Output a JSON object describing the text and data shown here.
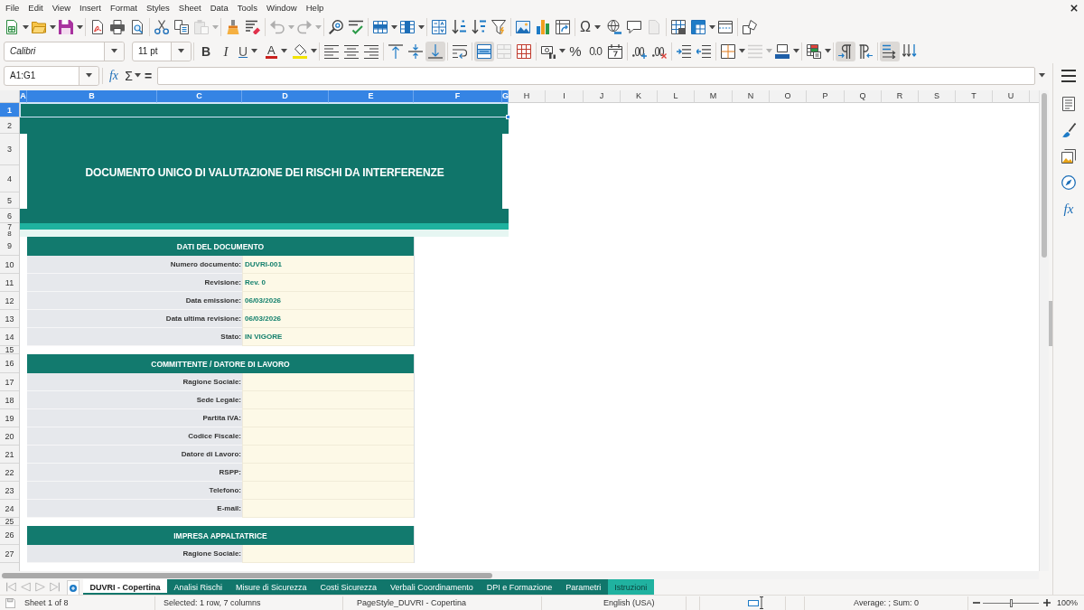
{
  "menu": [
    "File",
    "Edit",
    "View",
    "Insert",
    "Format",
    "Styles",
    "Sheet",
    "Data",
    "Tools",
    "Window",
    "Help"
  ],
  "toolbars": [
    {
      "groups": [
        [
          {
            "dropdown": true,
            "disabled": false,
            "pressed": false
          },
          {
            "dropdown": true,
            "disabled": false,
            "pressed": false
          },
          {
            "dropdown": true,
            "disabled": false,
            "pressed": false
          }
        ],
        [
          {
            "dropdown": false,
            "disabled": false,
            "pressed": false
          },
          {
            "dropdown": false,
            "disabled": false,
            "pressed": false
          },
          {
            "dropdown": false,
            "disabled": false,
            "pressed": false
          }
        ],
        [
          {
            "dropdown": false,
            "disabled": false,
            "pressed": false
          },
          {
            "dropdown": false,
            "disabled": false,
            "pressed": false
          },
          {
            "dropdown": true,
            "disabled": true,
            "pressed": false
          }
        ],
        [
          {
            "dropdown": false,
            "disabled": false,
            "pressed": false
          },
          {
            "dropdown": false,
            "disabled": false,
            "pressed": false
          }
        ],
        [
          {
            "dropdown": true,
            "disabled": true,
            "pressed": false
          },
          {
            "dropdown": true,
            "disabled": true,
            "pressed": false
          }
        ],
        [
          {
            "dropdown": false,
            "disabled": false,
            "pressed": false
          },
          {
            "dropdown": false,
            "disabled": false,
            "pressed": false
          }
        ],
        [
          {
            "dropdown": true,
            "disabled": false,
            "pressed": false
          },
          {
            "dropdown": true,
            "disabled": false,
            "pressed": false
          }
        ],
        [
          {
            "dropdown": false,
            "disabled": false,
            "pressed": false
          },
          {
            "dropdown": false,
            "disabled": false,
            "pressed": false
          },
          {
            "dropdown": false,
            "disabled": false,
            "pressed": false
          },
          {
            "dropdown": false,
            "disabled": false,
            "pressed": false
          }
        ],
        [
          {
            "dropdown": false,
            "disabled": false,
            "pressed": false
          },
          {
            "dropdown": false,
            "disabled": false,
            "pressed": false
          },
          {
            "dropdown": false,
            "disabled": false,
            "pressed": false
          }
        ],
        [
          {
            "label": "Ω",
            "dropdown": true,
            "disabled": false,
            "pressed": false
          },
          {
            "dropdown": false,
            "disabled": false,
            "pressed": false
          },
          {
            "dropdown": false,
            "disabled": false,
            "pressed": false
          },
          {
            "dropdown": false,
            "disabled": true,
            "pressed": false
          }
        ],
        [
          {
            "dropdown": false,
            "disabled": false,
            "pressed": false
          },
          {
            "dropdown": true,
            "disabled": false,
            "pressed": false
          },
          {
            "dropdown": false,
            "disabled": false,
            "pressed": false
          }
        ],
        [
          {
            "dropdown": false,
            "disabled": false,
            "pressed": false
          }
        ]
      ]
    },
    {
      "font_name": "Calibri",
      "font_size": "11 pt",
      "groups": [
        [
          {
            "label": "B",
            "dropdown": false,
            "disabled": false,
            "pressed": false
          },
          {
            "label": "I",
            "dropdown": false,
            "disabled": false,
            "pressed": false
          },
          {
            "label": "U",
            "dropdown": true,
            "disabled": false,
            "pressed": false
          },
          {
            "label": "A",
            "dropdown": true,
            "disabled": false,
            "pressed": false
          },
          {
            "dropdown": true,
            "disabled": false,
            "pressed": false
          }
        ],
        [
          {
            "dropdown": false,
            "disabled": false,
            "pressed": false
          },
          {
            "dropdown": false,
            "disabled": false,
            "pressed": false
          },
          {
            "dropdown": false,
            "disabled": false,
            "pressed": false
          }
        ],
        [
          {
            "dropdown": false,
            "disabled": false,
            "pressed": false
          },
          {
            "dropdown": false,
            "disabled": false,
            "pressed": false
          },
          {
            "dropdown": false,
            "disabled": false,
            "pressed": true
          }
        ],
        [
          {
            "dropdown": false,
            "disabled": false,
            "pressed": false
          }
        ],
        [
          {
            "dropdown": false,
            "disabled": false,
            "pressed": true
          },
          {
            "dropdown": false,
            "disabled": true,
            "pressed": false
          },
          {
            "dropdown": false,
            "disabled": false,
            "pressed": false
          }
        ],
        [
          {
            "dropdown": true,
            "disabled": false,
            "pressed": false
          },
          {
            "label": "%",
            "dropdown": false,
            "disabled": false,
            "pressed": false
          },
          {
            "label": "0.0",
            "dropdown": false,
            "disabled": false,
            "pressed": false
          },
          {
            "dropdown": false,
            "disabled": false,
            "pressed": false
          }
        ],
        [
          {
            "dropdown": false,
            "disabled": false,
            "pressed": false
          },
          {
            "dropdown": false,
            "disabled": false,
            "pressed": false
          }
        ],
        [
          {
            "dropdown": false,
            "disabled": false,
            "pressed": false
          },
          {
            "dropdown": false,
            "disabled": false,
            "pressed": false
          }
        ],
        [
          {
            "dropdown": true,
            "disabled": false,
            "pressed": false
          },
          {
            "dropdown": true,
            "disabled": true,
            "pressed": false
          },
          {
            "dropdown": true,
            "disabled": false,
            "pressed": false
          }
        ],
        [
          {
            "dropdown": true,
            "disabled": false,
            "pressed": false
          }
        ],
        [
          {
            "dropdown": false,
            "disabled": false,
            "pressed": true
          },
          {
            "dropdown": false,
            "disabled": false,
            "pressed": false
          }
        ],
        [
          {
            "dropdown": false,
            "disabled": false,
            "pressed": true
          },
          {
            "dropdown": false,
            "disabled": false,
            "pressed": false
          }
        ]
      ]
    }
  ],
  "formula_bar": {
    "name_box": "A1:G1",
    "function_label": "fx",
    "sum_label": "Σ",
    "equals_label": "="
  },
  "sidebar": {
    "functions_label": "fx"
  },
  "sheet": {
    "columns": [
      {
        "label": "A",
        "selected": true
      },
      {
        "label": "B",
        "selected": true
      },
      {
        "label": "C",
        "selected": true
      },
      {
        "label": "D",
        "selected": true
      },
      {
        "label": "E",
        "selected": true
      },
      {
        "label": "F",
        "selected": true
      },
      {
        "label": "G",
        "selected": true
      },
      {
        "label": "H",
        "selected": false
      },
      {
        "label": "I",
        "selected": false
      },
      {
        "label": "J",
        "selected": false
      },
      {
        "label": "K",
        "selected": false
      },
      {
        "label": "L",
        "selected": false
      },
      {
        "label": "M",
        "selected": false
      },
      {
        "label": "N",
        "selected": false
      },
      {
        "label": "O",
        "selected": false
      },
      {
        "label": "P",
        "selected": false
      },
      {
        "label": "Q",
        "selected": false
      },
      {
        "label": "R",
        "selected": false
      },
      {
        "label": "S",
        "selected": false
      },
      {
        "label": "T",
        "selected": false
      },
      {
        "label": "U",
        "selected": false
      }
    ],
    "rows": [
      {
        "label": "1",
        "selected": true
      },
      {
        "label": "2",
        "selected": false
      },
      {
        "label": "3",
        "selected": false
      },
      {
        "label": "4",
        "selected": false
      },
      {
        "label": "5",
        "selected": false
      },
      {
        "label": "6",
        "selected": false
      },
      {
        "label": "7",
        "selected": false
      },
      {
        "label": "8",
        "selected": false
      },
      {
        "label": "9",
        "selected": false
      },
      {
        "label": "10",
        "selected": false
      },
      {
        "label": "11",
        "selected": false
      },
      {
        "label": "12",
        "selected": false
      },
      {
        "label": "13",
        "selected": false
      },
      {
        "label": "14",
        "selected": false
      },
      {
        "label": "15",
        "selected": false
      },
      {
        "label": "16",
        "selected": false
      },
      {
        "label": "17",
        "selected": false
      },
      {
        "label": "18",
        "selected": false
      },
      {
        "label": "19",
        "selected": false
      },
      {
        "label": "20",
        "selected": false
      },
      {
        "label": "21",
        "selected": false
      },
      {
        "label": "22",
        "selected": false
      },
      {
        "label": "23",
        "selected": false
      },
      {
        "label": "24",
        "selected": false
      },
      {
        "label": "25",
        "selected": false
      },
      {
        "label": "26",
        "selected": false
      },
      {
        "label": "27",
        "selected": false
      }
    ],
    "title": "DOCUMENTO UNICO DI VALUTAZIONE DEI RISCHI DA INTERFERENZE",
    "sections": [
      {
        "heading": "DATI DEL DOCUMENTO",
        "fields": [
          {
            "label": "Numero documento:",
            "value": "DUVRI-001"
          },
          {
            "label": "Revisione:",
            "value": "Rev. 0"
          },
          {
            "label": "Data emissione:",
            "value": "06/03/2026"
          },
          {
            "label": "Data ultima revisione:",
            "value": "06/03/2026"
          },
          {
            "label": "Stato:",
            "value": "IN VIGORE"
          }
        ]
      },
      {
        "heading": "COMMITTENTE / DATORE DI LAVORO",
        "fields": [
          {
            "label": "Ragione Sociale:"
          },
          {
            "label": "Sede Legale:"
          },
          {
            "label": "Partita IVA:"
          },
          {
            "label": "Codice Fiscale:"
          },
          {
            "label": "Datore di Lavoro:"
          },
          {
            "label": "RSPP:"
          },
          {
            "label": "Telefono:"
          },
          {
            "label": "E-mail:"
          }
        ]
      },
      {
        "heading": "IMPRESA APPALTATRICE",
        "fields": [
          {
            "label": "Ragione Sociale:"
          }
        ]
      }
    ]
  },
  "sheet_tabs": [
    {
      "label": "DUVRI - Copertina",
      "selected": true,
      "color": "#11766b"
    },
    {
      "label": "Analisi Rischi",
      "selected": false,
      "color": "#11766b"
    },
    {
      "label": "Misure di Sicurezza",
      "selected": false,
      "color": "#11766b"
    },
    {
      "label": "Costi Sicurezza",
      "selected": false,
      "color": "#11766b"
    },
    {
      "label": "Verbali Coordinamento",
      "selected": false,
      "color": "#11766b"
    },
    {
      "label": "DPI e Formazione",
      "selected": false,
      "color": "#11766b"
    },
    {
      "label": "Parametri",
      "selected": false,
      "color": "#11766b"
    },
    {
      "label": "Istruzioni",
      "selected": false,
      "color": "#20b2a0"
    }
  ],
  "status_bar": {
    "sheet": "Sheet 1 of 8",
    "selection": "Selected: 1 row, 7 columns",
    "page_style": "PageStyle_DUVRI - Copertina",
    "language": "English (USA)",
    "summary": "Average: ; Sum: 0",
    "zoom_slider": {
      "level": 0.5
    },
    "zoom": "100%"
  }
}
